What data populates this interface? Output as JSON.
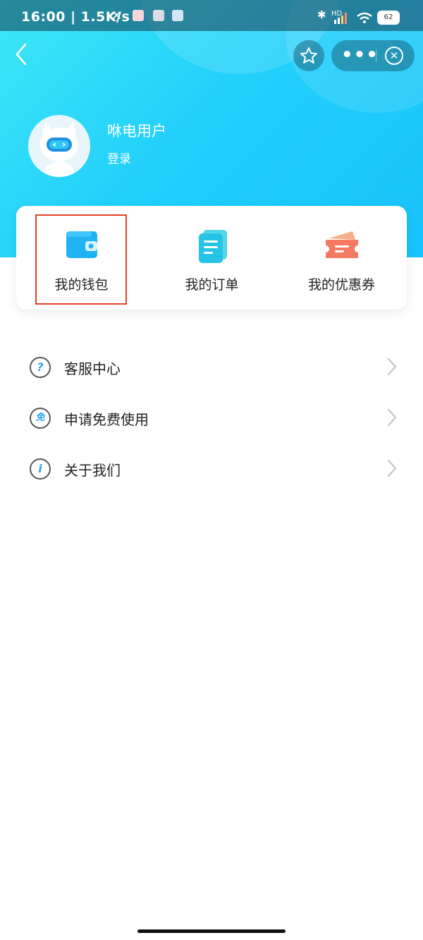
{
  "status_bar": {
    "time": "16:00 | 1.5K/s",
    "network_hd": "HD",
    "battery": "62"
  },
  "nav": {
    "back_icon": "chevron-left-icon",
    "star_icon": "star-icon",
    "more_icon": "•••",
    "close_icon": "close-circle-icon"
  },
  "profile": {
    "username": "咻电用户",
    "login": "登录"
  },
  "quick_actions": [
    {
      "label": "我的钱包",
      "icon": "wallet-icon",
      "color": "#1fb2f5"
    },
    {
      "label": "我的订单",
      "icon": "order-document-icon",
      "color": "#25c4e6"
    },
    {
      "label": "我的优惠券",
      "icon": "coupon-ticket-icon",
      "color": "#f57a63"
    }
  ],
  "menu": [
    {
      "label": "客服中心",
      "icon": "question-circle-icon",
      "glyph": "?"
    },
    {
      "label": "申请免费使用",
      "icon": "free-badge-icon",
      "glyph": "免"
    },
    {
      "label": "关于我们",
      "icon": "info-circle-icon",
      "glyph": "i"
    }
  ],
  "colors": {
    "header_gradient_start": "#3ee8f6",
    "header_gradient_end": "#18c2fb",
    "highlight_border": "#e34126"
  }
}
